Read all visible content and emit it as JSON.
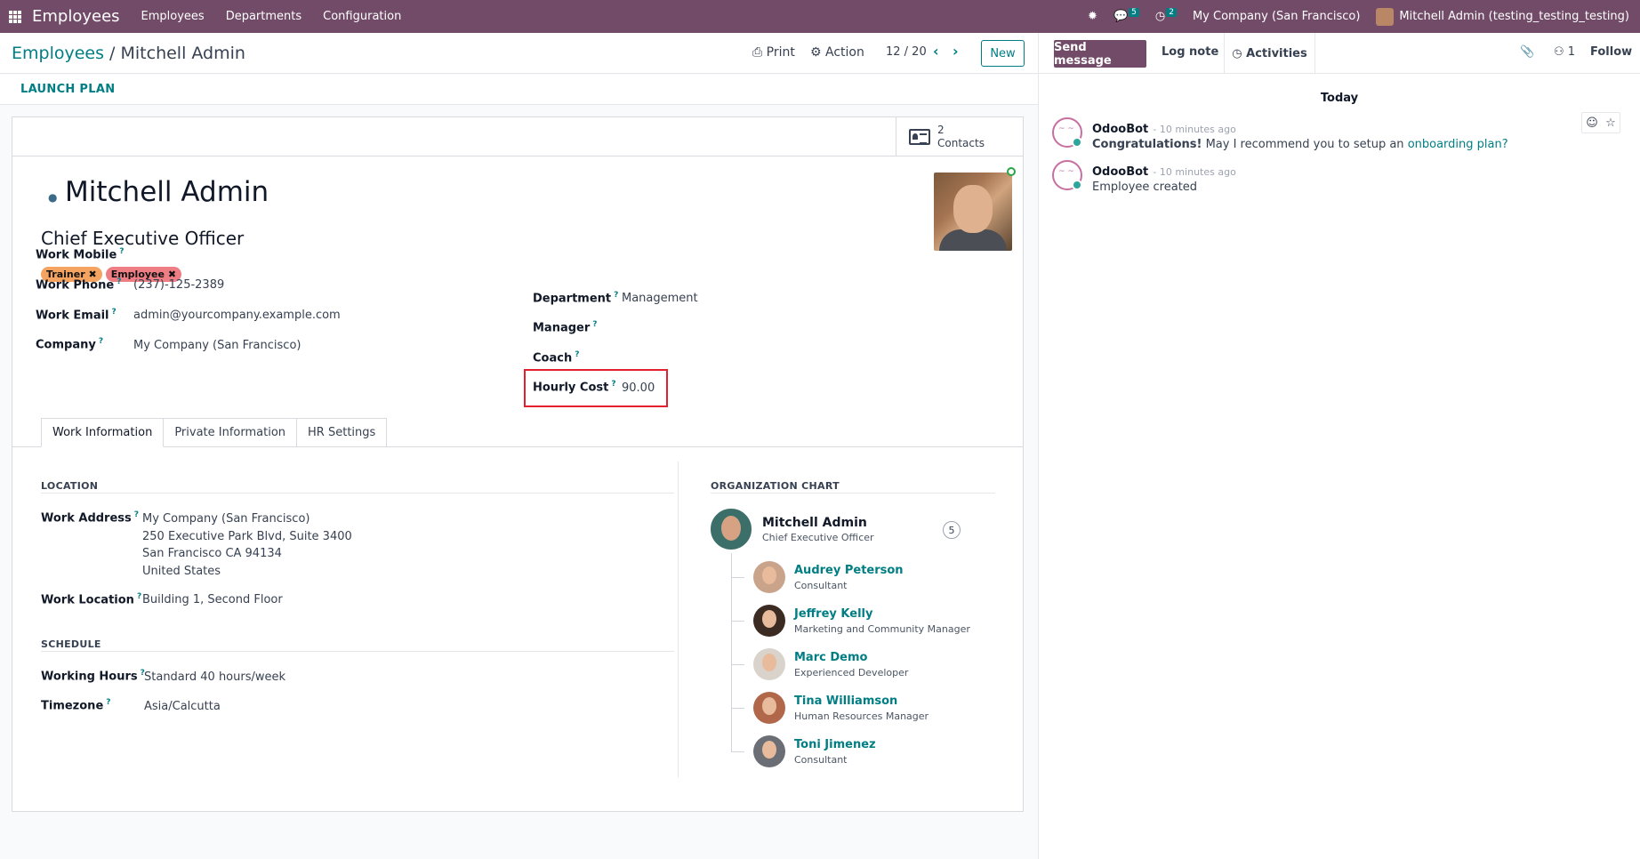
{
  "nav": {
    "brand": "Employees",
    "menu": [
      "Employees",
      "Departments",
      "Configuration"
    ],
    "messages_count": "5",
    "activities_count": "2",
    "company": "My Company (San Francisco)",
    "user": "Mitchell Admin (testing_testing_testing)"
  },
  "control": {
    "breadcrumb_root": "Employees",
    "breadcrumb_sep": "/",
    "breadcrumb_current": "Mitchell Admin",
    "print_label": "Print",
    "action_label": "Action",
    "pager": "12 / 20",
    "new_label": "New"
  },
  "status": {
    "launch_plan": "LAUNCH PLAN"
  },
  "button_box": {
    "contacts_count": "2",
    "contacts_label": "Contacts"
  },
  "employee": {
    "name": "Mitchell Admin",
    "job_title": "Chief Executive Officer",
    "tags": [
      "Trainer",
      "Employee"
    ]
  },
  "fields": {
    "work_mobile_label": "Work Mobile",
    "work_mobile": "",
    "work_phone_label": "Work Phone",
    "work_phone": "(237)-125-2389",
    "work_email_label": "Work Email",
    "work_email": "admin@yourcompany.example.com",
    "company_label": "Company",
    "company": "My Company (San Francisco)",
    "department_label": "Department",
    "department": "Management",
    "manager_label": "Manager",
    "manager": "",
    "coach_label": "Coach",
    "coach": "",
    "hourly_cost_label": "Hourly Cost",
    "hourly_cost": "90.00",
    "help": "?"
  },
  "tabs": [
    "Work Information",
    "Private Information",
    "HR Settings"
  ],
  "work_info": {
    "location_title": "LOCATION",
    "work_address_label": "Work Address",
    "work_address_lines": [
      "My Company (San Francisco)",
      "250 Executive Park Blvd, Suite 3400",
      "San Francisco CA 94134",
      "United States"
    ],
    "work_location_label": "Work Location",
    "work_location": "Building 1, Second Floor",
    "schedule_title": "SCHEDULE",
    "working_hours_label": "Working Hours",
    "working_hours": "Standard 40 hours/week",
    "timezone_label": "Timezone",
    "timezone": "Asia/Calcutta"
  },
  "org_chart": {
    "title": "ORGANIZATION CHART",
    "root_name": "Mitchell Admin",
    "root_title": "Chief Executive Officer",
    "count": "5",
    "subordinates": [
      {
        "name": "Audrey Peterson",
        "title": "Consultant"
      },
      {
        "name": "Jeffrey Kelly",
        "title": "Marketing and Community Manager"
      },
      {
        "name": "Marc Demo",
        "title": "Experienced Developer"
      },
      {
        "name": "Tina Williamson",
        "title": "Human Resources Manager"
      },
      {
        "name": "Toni Jimenez",
        "title": "Consultant"
      }
    ]
  },
  "chatter": {
    "send_message": "Send message",
    "log_note": "Log note",
    "activities": "Activities",
    "followers_count": "1",
    "follow": "Follow",
    "today": "Today",
    "messages": [
      {
        "author": "OdooBot",
        "time": "- 10 minutes ago",
        "text_bold": "Congratulations!",
        "text": " May I recommend you to setup an ",
        "link": "onboarding plan?"
      },
      {
        "author": "OdooBot",
        "time": "- 10 minutes ago",
        "text": "Employee created"
      }
    ]
  }
}
